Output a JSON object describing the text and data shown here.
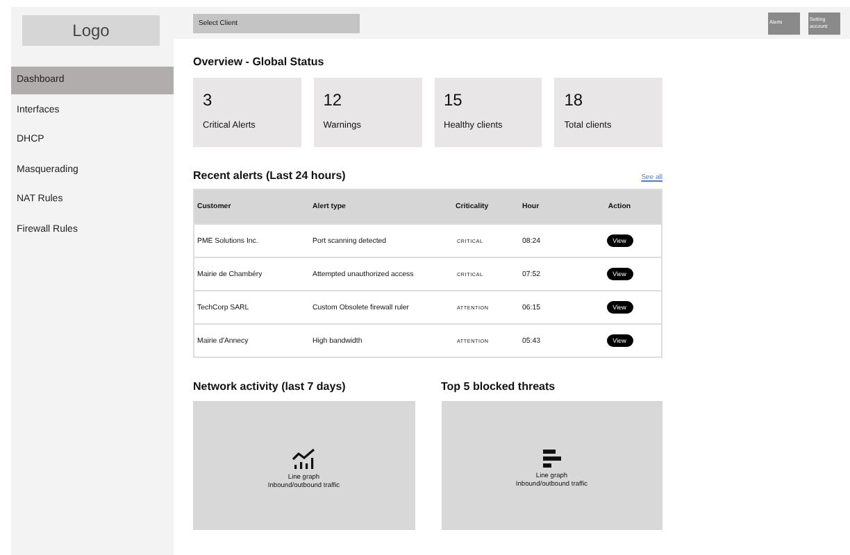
{
  "logo": "Logo",
  "client_select": {
    "placeholder": "Select Client"
  },
  "header_buttons": [
    "Alerts",
    "Setting account"
  ],
  "sidebar": {
    "items": [
      {
        "label": "Dashboard",
        "selected": true
      },
      {
        "label": "Interfaces",
        "selected": false
      },
      {
        "label": "DHCP",
        "selected": false
      },
      {
        "label": "Masquerading",
        "selected": false
      },
      {
        "label": "NAT Rules",
        "selected": false
      },
      {
        "label": "Firewall Rules",
        "selected": false
      }
    ]
  },
  "overview": {
    "title": "Overview - Global Status",
    "cards": [
      {
        "value": "3",
        "label": "Critical Alerts"
      },
      {
        "value": "12",
        "label": "Warnings"
      },
      {
        "value": "15",
        "label": "Healthy clients"
      },
      {
        "value": "18",
        "label": "Total clients"
      }
    ]
  },
  "alerts": {
    "title": "Recent alerts (Last 24 hours)",
    "see_all": "See all",
    "columns": [
      "Customer",
      "Alert type",
      "Criticality",
      "Hour",
      "Action"
    ],
    "rows": [
      {
        "customer": "PME Solutions Inc.",
        "alert_type": "Port scanning detected",
        "criticality": "CRITICAL",
        "hour": "08:24",
        "action": "View"
      },
      {
        "customer": "Mairie de Chambéry",
        "alert_type": "Attempted unauthorized access",
        "criticality": "CRITICAL",
        "hour": "07:52",
        "action": "View"
      },
      {
        "customer": "TechCorp SARL",
        "alert_type": "Custom Obsolete firewall ruler",
        "criticality": "ATTENTION",
        "hour": "06:15",
        "action": "View"
      },
      {
        "customer": "Mairie d'Annecy",
        "alert_type": "High bandwidth",
        "criticality": "ATTENTION",
        "hour": "05:43",
        "action": "View"
      }
    ]
  },
  "panels": [
    {
      "title": "Network activity (last 7 days)",
      "kind": "line",
      "caption": "Line graph",
      "subcaption": "Inbound/outbound traffic"
    },
    {
      "title": "Top 5 blocked threats",
      "kind": "bars",
      "caption": "Line graph",
      "subcaption": "Inbound/outbound traffic"
    }
  ]
}
